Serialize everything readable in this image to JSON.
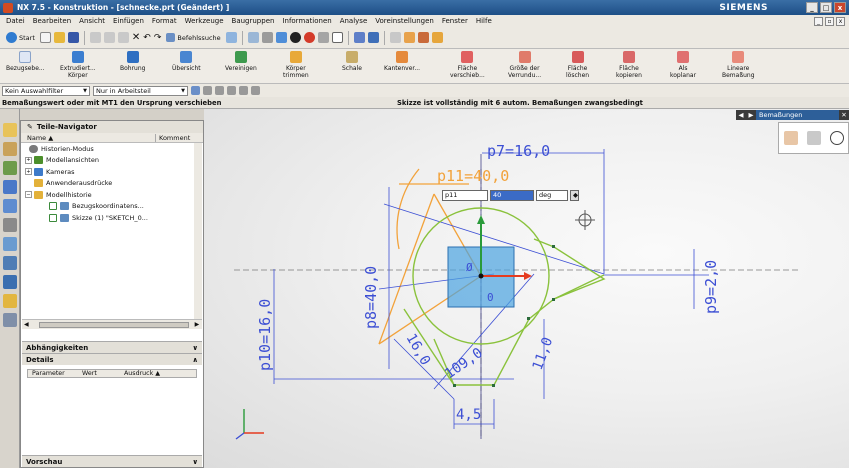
{
  "window": {
    "title": "NX 7.5 - Konstruktion - [schnecke.prt (Geändert) ]",
    "brand": "SIEMENS",
    "buttons": [
      "_",
      "□",
      "x"
    ]
  },
  "menubar": {
    "items": [
      "Datei",
      "Bearbeiten",
      "Ansicht",
      "Einfügen",
      "Format",
      "Werkzeuge",
      "Baugruppen",
      "Informationen",
      "Analyse",
      "Voreinstellungen",
      "Fenster",
      "Hilfe"
    ]
  },
  "toolbar": {
    "start_label": "Start",
    "befehlssuche_label": "Befehlssuche"
  },
  "ribbon": {
    "items": [
      {
        "line1": "Bezugsebe...",
        "line2": ""
      },
      {
        "line1": "Extrudiert...",
        "line2": "Körper"
      },
      {
        "line1": "Bohrung",
        "line2": ""
      },
      {
        "line1": "Übersicht",
        "line2": ""
      },
      {
        "line1": "Vereinigen",
        "line2": ""
      },
      {
        "line1": "Körper",
        "line2": "trimmen"
      },
      {
        "line1": "Schale",
        "line2": ""
      },
      {
        "line1": "Kantenver...",
        "line2": ""
      },
      {
        "line1": "Fläche",
        "line2": "verschieb..."
      },
      {
        "line1": "Größe der",
        "line2": "Verrundu..."
      },
      {
        "line1": "Fläche",
        "line2": "löschen"
      },
      {
        "line1": "Fläche",
        "line2": "kopieren"
      },
      {
        "line1": "Als",
        "line2": "koplanar"
      },
      {
        "line1": "Lineare",
        "line2": "Bemaßung"
      }
    ]
  },
  "filterbar": {
    "filter": "Kein Auswahlfilter",
    "scope": "Nur in Arbeitsteil"
  },
  "status": {
    "cue": "Bemaßungswert oder mit MT1 den Ursprung verschieben",
    "message": "Skizze ist vollständig mit 6 autom. Bemaßungen zwangsbedingt"
  },
  "navigator": {
    "title": "Teile-Navigator",
    "col_name": "Name",
    "col_comment": "Komment",
    "nodes": [
      {
        "label": "Historien-Modus",
        "color": "#7a7a7a"
      },
      {
        "label": "Modellansichten",
        "color": "#4c8f2b"
      },
      {
        "label": "Kameras",
        "color": "#3d7ac9"
      },
      {
        "label": "Anwenderausdrücke",
        "color": "#e3b13a"
      },
      {
        "label": "Modellhistorie",
        "color": "#e3b13a"
      },
      {
        "label": "Bezugskoordinatens...",
        "color": "#5d8bbf"
      },
      {
        "label": "Skizze (1) \"SKETCH_0...",
        "color": "#5d8bbf"
      }
    ],
    "sections": {
      "abhaengigkeiten": "Abhängigkeiten",
      "details": "Details",
      "vorschau": "Vorschau"
    },
    "details_columns": [
      "Parameter",
      "Wert",
      "Ausdruck"
    ]
  },
  "bemassungen": {
    "title": "Bemaßungen"
  },
  "dialog": {
    "name": "p11",
    "value": "40",
    "unit": "deg"
  },
  "sketch": {
    "dim_p7": "p7=16,0",
    "dim_p11": "p11=40,0",
    "dim_p8": "p8=40,0",
    "dim_p9": "p9=2,0",
    "dim_p10": "p10=16,0",
    "dim_left": "16,0",
    "dim_bottom_angle": "109,0",
    "dim_right_len": "11,0",
    "dim_bottom": "4,5",
    "small_1": "Ø",
    "small_2": "0"
  },
  "colors": {
    "green": "#8ac23c",
    "orange": "#f2a23a",
    "blue": "#3c4fd4",
    "square": "#4aa3e0"
  }
}
